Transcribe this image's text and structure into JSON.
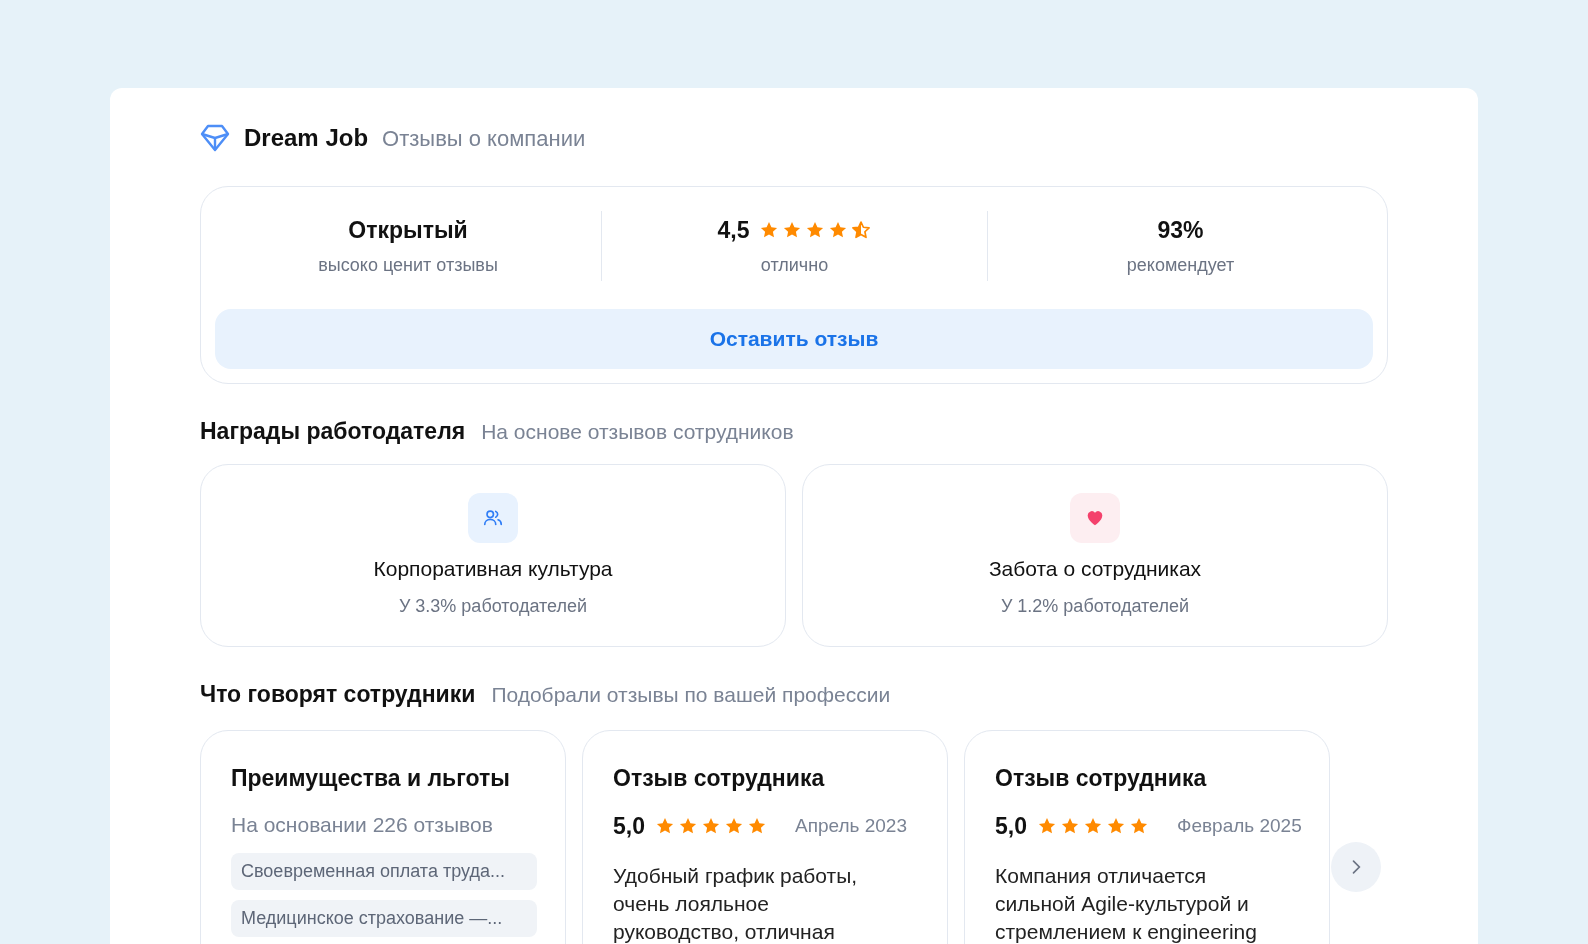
{
  "header": {
    "brand": "Dream Job",
    "subtitle": "Отзывы о компании"
  },
  "stats": [
    {
      "kind": "text",
      "value": "Открытый",
      "caption": "высоко ценит отзывы"
    },
    {
      "kind": "rating",
      "value": "4,5",
      "stars": 4.5,
      "caption": "отлично"
    },
    {
      "kind": "text",
      "value": "93%",
      "caption": "рекомендует"
    }
  ],
  "review_button": "Оставить отзыв",
  "awards_section": {
    "title": "Награды работодателя",
    "subtitle": "На основе отзывов сотрудников"
  },
  "awards": [
    {
      "kind": "people",
      "title": "Корпоративная культура",
      "caption": "У 3.3% работодателей"
    },
    {
      "kind": "heart",
      "title": "Забота о сотрудниках",
      "caption": "У 1.2% работодателей"
    }
  ],
  "reviews_section": {
    "title": "Что говорят сотрудники",
    "subtitle": "Подобрали отзывы по вашей профессии"
  },
  "review_cards": [
    {
      "kind": "benefits",
      "title": "Преимущества и льготы",
      "subtitle": "На основании 226 отзывов",
      "tags": [
        "Своевременная оплата труда...",
        "Медицинское страхование —..."
      ]
    },
    {
      "kind": "review",
      "title": "Отзыв сотрудника",
      "rating": "5,0",
      "stars": 5,
      "date": "Апрель 2023",
      "text": "Удобный график работы, очень лояльное руководство, отличная"
    },
    {
      "kind": "review",
      "title": "Отзыв сотрудника",
      "rating": "5,0",
      "stars": 5,
      "date": "Февраль 2025",
      "text": "Компания отличается сильной Agile-культурой и стремлением к engineering"
    }
  ]
}
